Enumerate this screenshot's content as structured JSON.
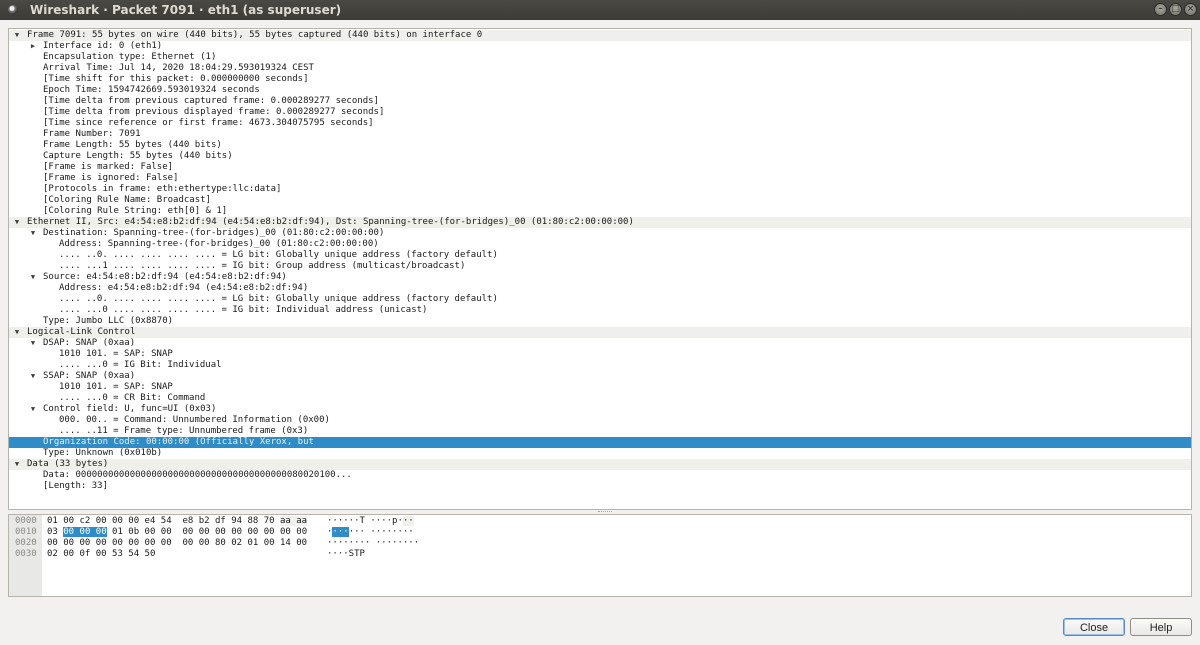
{
  "window": {
    "title": "Wireshark · Packet 7091 · eth1 (as superuser)",
    "buttons": [
      "minimize",
      "maximize",
      "close"
    ]
  },
  "tree": [
    {
      "text": "Frame 7091: 55 bytes on wire (440 bits), 55 bytes captured (440 bits) on interface 0",
      "expander": "expanded",
      "toplevel": true
    },
    {
      "text": "Interface id: 0 (eth1)",
      "expander": "collapsed"
    },
    {
      "text": "Encapsulation type: Ethernet (1)"
    },
    {
      "text": "Arrival Time: Jul 14, 2020 18:04:29.593019324 CEST"
    },
    {
      "text": "[Time shift for this packet: 0.000000000 seconds]"
    },
    {
      "text": "Epoch Time: 1594742669.593019324 seconds"
    },
    {
      "text": "[Time delta from previous captured frame: 0.000289277 seconds]"
    },
    {
      "text": "[Time delta from previous displayed frame: 0.000289277 seconds]"
    },
    {
      "text": "[Time since reference or first frame: 4673.304075795 seconds]"
    },
    {
      "text": "Frame Number: 7091"
    },
    {
      "text": "Frame Length: 55 bytes (440 bits)"
    },
    {
      "text": "Capture Length: 55 bytes (440 bits)"
    },
    {
      "text": "[Frame is marked: False]"
    },
    {
      "text": "[Frame is ignored: False]"
    },
    {
      "text": "[Protocols in frame: eth:ethertype:llc:data]"
    },
    {
      "text": "[Coloring Rule Name: Broadcast]"
    },
    {
      "text": "[Coloring Rule String: eth[0] & 1]"
    },
    {
      "text": "Ethernet II, Src: e4:54:e8:b2:df:94 (e4:54:e8:b2:df:94), Dst: Spanning-tree-(for-bridges)_00 (01:80:c2:00:00:00)",
      "expander": "expanded",
      "toplevel": true
    },
    {
      "text": "Destination: Spanning-tree-(for-bridges)_00 (01:80:c2:00:00:00)",
      "expander": "expanded"
    },
    {
      "text": "Address: Spanning-tree-(for-bridges)_00 (01:80:c2:00:00:00)",
      "indent2": true
    },
    {
      "text": ".... ..0. .... .... .... .... = LG bit: Globally unique address (factory default)",
      "indent2": true
    },
    {
      "text": ".... ...1 .... .... .... .... = IG bit: Group address (multicast/broadcast)",
      "indent2": true
    },
    {
      "text": "Source: e4:54:e8:b2:df:94 (e4:54:e8:b2:df:94)",
      "expander": "expanded"
    },
    {
      "text": "Address: e4:54:e8:b2:df:94 (e4:54:e8:b2:df:94)",
      "indent2": true
    },
    {
      "text": ".... ..0. .... .... .... .... = LG bit: Globally unique address (factory default)",
      "indent2": true
    },
    {
      "text": ".... ...0 .... .... .... .... = IG bit: Individual address (unicast)",
      "indent2": true
    },
    {
      "text": "Type: Jumbo LLC (0x8870)"
    },
    {
      "text": "Logical-Link Control",
      "expander": "expanded",
      "toplevel": true
    },
    {
      "text": "DSAP: SNAP (0xaa)",
      "expander": "expanded"
    },
    {
      "text": "1010 101. = SAP: SNAP",
      "indent2": true
    },
    {
      "text": ".... ...0 = IG Bit: Individual",
      "indent2": true
    },
    {
      "text": "SSAP: SNAP (0xaa)",
      "expander": "expanded"
    },
    {
      "text": "1010 101. = SAP: SNAP",
      "indent2": true
    },
    {
      "text": ".... ...0 = CR Bit: Command",
      "indent2": true
    },
    {
      "text": "Control field: U, func=UI (0x03)",
      "expander": "expanded"
    },
    {
      "text": "000. 00.. = Command: Unnumbered Information (0x00)",
      "indent2": true
    },
    {
      "text": ".... ..11 = Frame type: Unnumbered frame (0x3)",
      "indent2": true
    },
    {
      "text": "Organization Code: 00:00:00 (Officially Xerox, but",
      "selected": true
    },
    {
      "text": "Type: Unknown (0x010b)"
    },
    {
      "text": "Data (33 bytes)",
      "expander": "expanded",
      "toplevel": true
    },
    {
      "text": "Data: 000000000000000000000000000000000000000080020100..."
    },
    {
      "text": "[Length: 33]"
    }
  ],
  "bytes": [
    {
      "offset": "0000",
      "hex": [
        [
          "01 00 c2 00 00 00 e4 54  e8 b2 df 94 88 70 ",
          ""
        ],
        [
          "aa aa",
          "dim"
        ]
      ],
      "ascii": [
        [
          "······T ····p·",
          ""
        ],
        [
          "··",
          "dim"
        ]
      ]
    },
    {
      "offset": "0010",
      "hex": [
        [
          "03 ",
          ""
        ],
        [
          "00 00 00",
          "hl"
        ],
        [
          " 01 0b 00 00  00 00 00 00 00 00 00 00",
          ""
        ]
      ],
      "ascii": [
        [
          "·",
          ""
        ],
        [
          "···",
          "hl"
        ],
        [
          "··· ········",
          ""
        ]
      ]
    },
    {
      "offset": "0020",
      "hex": [
        [
          "00 00 00 00 00 00 00 00  00 00 80 02 01 00 14 00",
          ""
        ]
      ],
      "ascii": [
        [
          "········ ········",
          ""
        ]
      ]
    },
    {
      "offset": "0030",
      "hex": [
        [
          "02 00 0f 00 53 54 50",
          ""
        ]
      ],
      "ascii": [
        [
          "····STP",
          ""
        ]
      ]
    }
  ],
  "buttons": {
    "close": "Close",
    "help": "Help"
  }
}
